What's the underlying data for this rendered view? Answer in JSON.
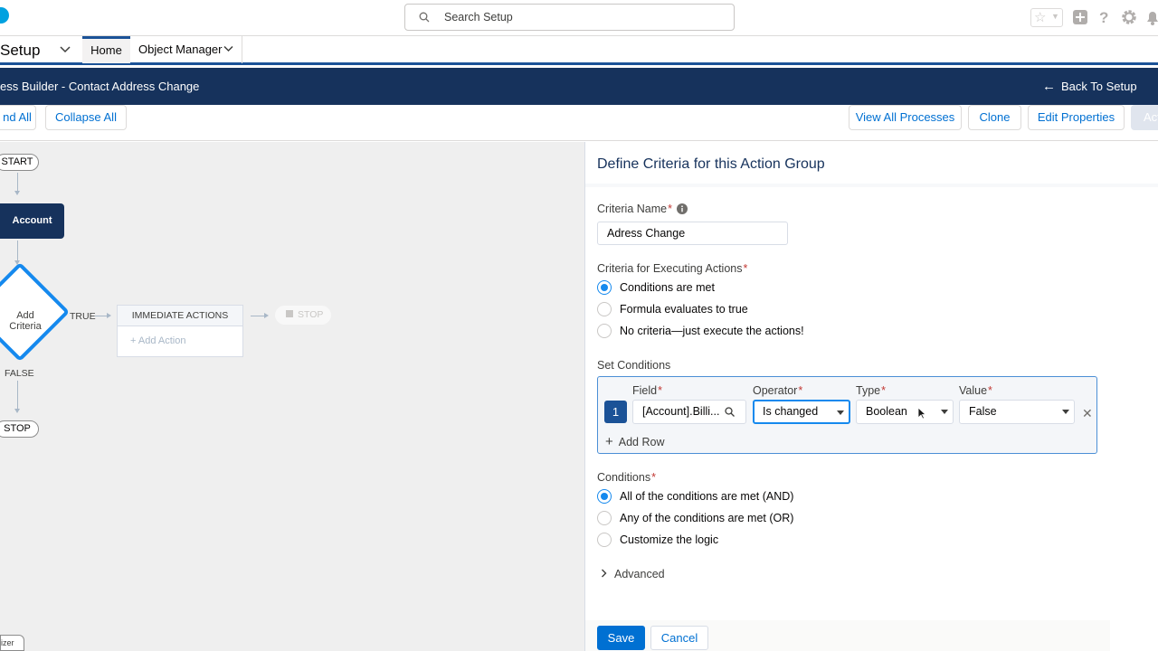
{
  "header": {
    "search_placeholder": "Search Setup",
    "icons": [
      "favorites-star-icon",
      "global-actions-plus-icon",
      "help-icon",
      "setup-gear-icon",
      "notifications-bell-icon"
    ]
  },
  "app_nav": {
    "app_name": "Setup",
    "tabs": [
      {
        "label": "Home",
        "active": true
      },
      {
        "label": "Object Manager",
        "active": false
      }
    ]
  },
  "builder_bar": {
    "title": "ess Builder - Contact Address Change",
    "back_label": "Back To Setup"
  },
  "toolbar": {
    "expand_all": "nd All",
    "collapse_all": "Collapse All",
    "view_all_processes": "View All Processes",
    "clone": "Clone",
    "edit_properties": "Edit Properties",
    "activate": "Act"
  },
  "canvas": {
    "start": "START",
    "object_node": "Account",
    "criteria_node": "Add Criteria",
    "true_label": "TRUE",
    "false_label": "FALSE",
    "immediate_actions": "IMMEDIATE ACTIONS",
    "add_action": "Add Action",
    "stop_ghost": "STOP",
    "stop": "STOP",
    "zoom_tab": "izer"
  },
  "panel": {
    "title": "Define Criteria for this Action Group",
    "criteria_name_label": "Criteria Name",
    "criteria_name_value": "Adress Change",
    "executing_label": "Criteria for Executing Actions",
    "executing_options": [
      {
        "label": "Conditions are met",
        "checked": true
      },
      {
        "label": "Formula evaluates to true",
        "checked": false
      },
      {
        "label": "No criteria—just execute the actions!",
        "checked": false
      }
    ],
    "set_conditions_label": "Set Conditions",
    "columns": {
      "field": "Field",
      "operator": "Operator",
      "type": "Type",
      "value": "Value"
    },
    "row": {
      "number": "1",
      "field": "[Account].Billi...",
      "operator": "Is changed",
      "type": "Boolean",
      "value": "False"
    },
    "add_row": "Add Row",
    "conditions_label": "Conditions",
    "condition_options": [
      {
        "label": "All of the conditions are met (AND)",
        "checked": true
      },
      {
        "label": "Any of the conditions are met (OR)",
        "checked": false
      },
      {
        "label": "Customize the logic",
        "checked": false
      }
    ],
    "advanced": "Advanced",
    "save": "Save",
    "cancel": "Cancel"
  },
  "colors": {
    "brand_dark": "#16325c",
    "accent_blue": "#0070d2",
    "radio_blue": "#1589ee"
  }
}
